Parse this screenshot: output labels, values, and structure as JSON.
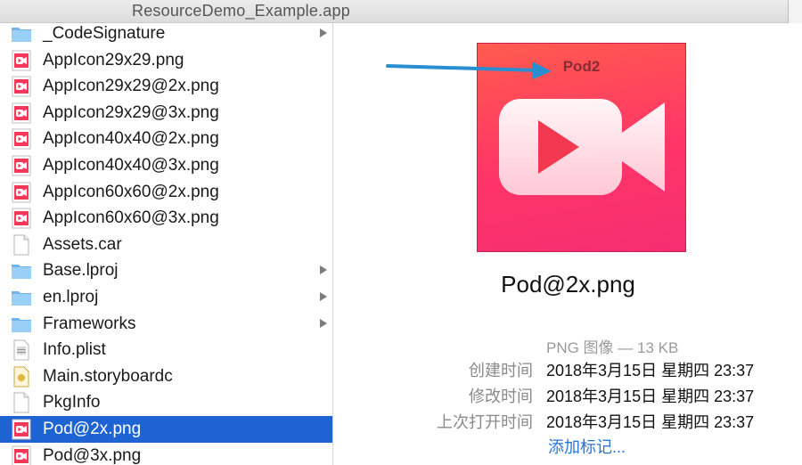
{
  "window": {
    "title": "ResourceDemo_Example.app"
  },
  "files": [
    {
      "name": "_CodeSignature",
      "icon": "folder-icon",
      "has_children": true,
      "selected": false
    },
    {
      "name": "AppIcon29x29.png",
      "icon": "png-image-icon",
      "has_children": false,
      "selected": false
    },
    {
      "name": "AppIcon29x29@2x.png",
      "icon": "png-image-icon",
      "has_children": false,
      "selected": false
    },
    {
      "name": "AppIcon29x29@3x.png",
      "icon": "png-image-icon",
      "has_children": false,
      "selected": false
    },
    {
      "name": "AppIcon40x40@2x.png",
      "icon": "png-image-icon",
      "has_children": false,
      "selected": false
    },
    {
      "name": "AppIcon40x40@3x.png",
      "icon": "png-image-icon",
      "has_children": false,
      "selected": false
    },
    {
      "name": "AppIcon60x60@2x.png",
      "icon": "png-image-icon",
      "has_children": false,
      "selected": false
    },
    {
      "name": "AppIcon60x60@3x.png",
      "icon": "png-image-icon",
      "has_children": false,
      "selected": false
    },
    {
      "name": "Assets.car",
      "icon": "blank-document-icon",
      "has_children": false,
      "selected": false
    },
    {
      "name": "Base.lproj",
      "icon": "folder-icon",
      "has_children": true,
      "selected": false
    },
    {
      "name": "en.lproj",
      "icon": "folder-icon",
      "has_children": true,
      "selected": false
    },
    {
      "name": "Frameworks",
      "icon": "folder-icon",
      "has_children": true,
      "selected": false
    },
    {
      "name": "Info.plist",
      "icon": "plist-document-icon",
      "has_children": false,
      "selected": false
    },
    {
      "name": "Main.storyboardc",
      "icon": "storyboard-icon",
      "has_children": false,
      "selected": false
    },
    {
      "name": "PkgInfo",
      "icon": "blank-document-icon",
      "has_children": false,
      "selected": false
    },
    {
      "name": "Pod@2x.png",
      "icon": "png-image-icon",
      "has_children": false,
      "selected": true
    },
    {
      "name": "Pod@3x.png",
      "icon": "png-image-icon",
      "has_children": false,
      "selected": false
    }
  ],
  "preview": {
    "image_text": "Pod2",
    "filename": "Pod@2x.png",
    "kind": "PNG 图像 — 13 KB",
    "meta": [
      {
        "key": "创建时间",
        "value": "2018年3月15日 星期四 23:37"
      },
      {
        "key": "修改时间",
        "value": "2018年3月15日 星期四 23:37"
      },
      {
        "key": "上次打开时间",
        "value": "2018年3月15日 星期四 23:37"
      }
    ],
    "add_tags": "添加标记..."
  },
  "colors": {
    "selection": "#1e63d4",
    "link": "#2a73d9",
    "arrow": "#2a8fd0",
    "thumb_gradient_start": "#ff5b4e",
    "thumb_gradient_end": "#f52e72"
  }
}
